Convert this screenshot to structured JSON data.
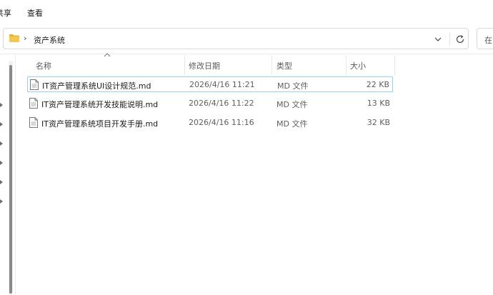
{
  "menu": {
    "share": "共享",
    "view": "查看"
  },
  "address": {
    "breadcrumb": "资产系统",
    "search_placeholder": "在"
  },
  "columns": {
    "name": "名称",
    "date": "修改日期",
    "type": "类型",
    "size": "大小"
  },
  "files": [
    {
      "name": "IT资产管理系统UI设计规范.md",
      "date": "2026/4/16 11:21",
      "type": "MD 文件",
      "size": "22 KB"
    },
    {
      "name": "IT资产管理系统开发技能说明.md",
      "date": "2026/4/16 11:22",
      "type": "MD 文件",
      "size": "13 KB"
    },
    {
      "name": "IT资产管理系统项目开发手册.md",
      "date": "2026/4/16 11:16",
      "type": "MD 文件",
      "size": "32 KB"
    }
  ],
  "icons": [
    "folder-icon",
    "chevron-right-icon",
    "chevron-down-icon",
    "refresh-icon",
    "file-icon",
    "sort-ascending-icon"
  ],
  "colors": {
    "folder": "#e8b53a",
    "selection_border": "#99d1f5"
  }
}
